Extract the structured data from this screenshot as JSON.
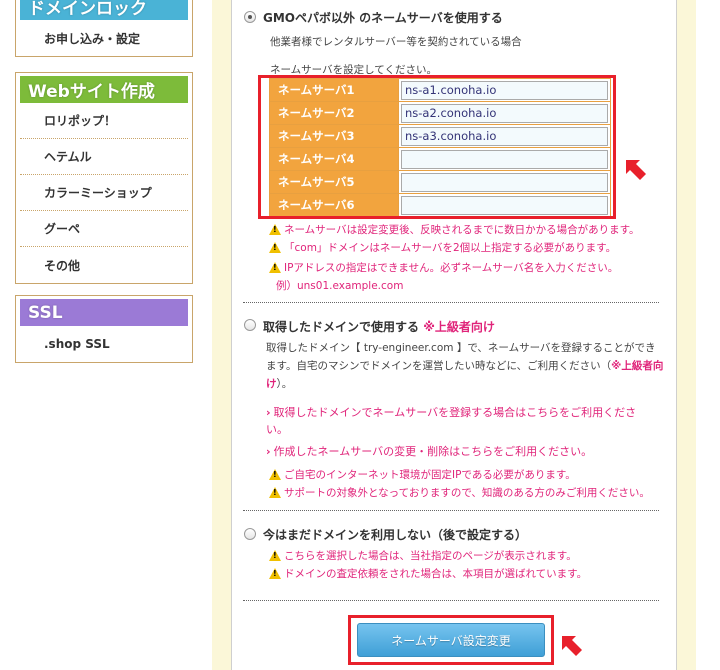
{
  "sidebar": {
    "domain_lock": {
      "title": "ドメインロック",
      "items": [
        "お申し込み・設定"
      ],
      "color": "#4ab3d6"
    },
    "website": {
      "title": "Webサイト作成",
      "items": [
        "ロリポップ！",
        "ヘテムル",
        "カラーミーショップ",
        "グーペ",
        "その他"
      ],
      "color": "#7dbb3a"
    },
    "ssl": {
      "title": "SSL",
      "items": [
        ".shop SSL"
      ],
      "color": "#9b7ad6"
    }
  },
  "option1": {
    "title": "GMOペパボ以外 のネームサーバを使用する",
    "desc": "他業者様でレンタルサーバー等を契約されている場合",
    "instruction": "ネームサーバを設定してください。",
    "checked": true
  },
  "nameservers": [
    {
      "label": "ネームサーバ1",
      "value": "ns-a1.conoha.io"
    },
    {
      "label": "ネームサーバ2",
      "value": "ns-a2.conoha.io"
    },
    {
      "label": "ネームサーバ3",
      "value": "ns-a3.conoha.io"
    },
    {
      "label": "ネームサーバ4",
      "value": ""
    },
    {
      "label": "ネームサーバ5",
      "value": ""
    },
    {
      "label": "ネームサーバ6",
      "value": ""
    }
  ],
  "notes1": [
    "ネームサーバは設定変更後、反映されるまでに数日かかる場合があります。",
    "「com」ドメインはネームサーバを2個以上指定する必要があります。",
    "IPアドレスの指定はできません。必ずネームサーバ名を入力ください。"
  ],
  "example": "例）uns01.example.com",
  "option2": {
    "title": "取得したドメインで使用する",
    "tag": "※上級者向け",
    "desc_line1": "取得したドメイン【 try-engineer.com 】で、ネームサーバを登録することができ",
    "desc_line2_a": "ます。自宅のマシンでドメインを運営したい時などに、ご利用ください（",
    "desc_line2_tag": "※上級者向",
    "desc_line3_tag": "け",
    "desc_line3_b": "）。",
    "link1": "取得したドメインでネームサーバを登録する場合はこちらをご利用くださ",
    "link1_cont": "い。",
    "link2": "作成したネームサーバの変更・削除はこちらをご利用ください。",
    "notes": [
      "ご自宅のインターネット環境が固定IPである必要があります。",
      "サポートの対象外となっておりますので、知識のある方のみご利用ください。"
    ]
  },
  "option3": {
    "title": "今はまだドメインを利用しない（後で設定する）",
    "notes": [
      "こちらを選択した場合は、当社指定のページが表示されます。",
      "ドメインの査定依頼をされた場合は、本項目が選ばれています。"
    ]
  },
  "submit_label": "ネームサーバ設定変更",
  "colors": {
    "accent_red": "#e8202b",
    "ns_label_bg": "#f2a43e",
    "warning_text": "#e0247a",
    "button": "#4aa8dc"
  }
}
